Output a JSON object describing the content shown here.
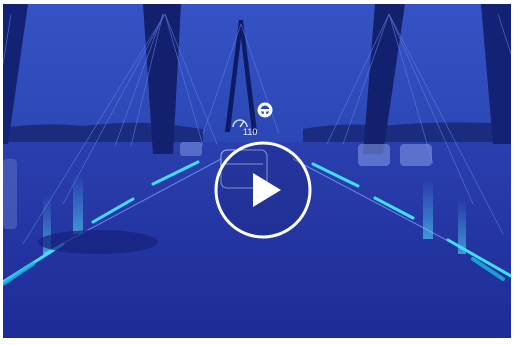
{
  "video": {
    "speed_readout": "110",
    "icons": [
      "steering-wheel-icon",
      "speedometer-icon",
      "play-icon"
    ]
  },
  "colors": {
    "sky": "#2a48b8",
    "road": "#1f2fa0",
    "lane_accent": "#3fe0ff",
    "play_ring": "#ffffff"
  }
}
